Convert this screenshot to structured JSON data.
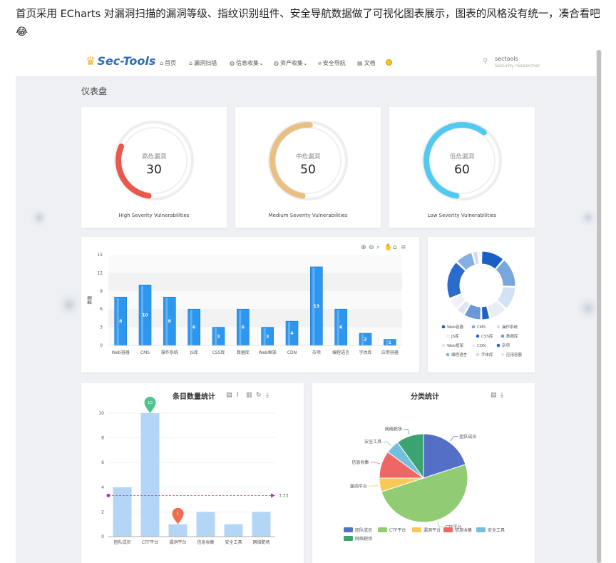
{
  "post": {
    "text": "首页采用 ECharts 对漏洞扫描的漏洞等级、指纹识别组件、安全导航数据做了可视化图表展示，图表的风格没有统一，凑合看吧😂"
  },
  "nav": {
    "logo": "Sec-Tools",
    "items": [
      {
        "icon": "home-icon",
        "label": "首页"
      },
      {
        "icon": "bank-icon",
        "label": "漏洞扫描"
      },
      {
        "icon": "globe-icon",
        "label": "信息收集⌄"
      },
      {
        "icon": "globe-icon",
        "label": "资产收集⌄"
      },
      {
        "icon": "ie-icon",
        "label": "安全导航"
      },
      {
        "icon": "file-icon",
        "label": "文档"
      }
    ],
    "user": {
      "name": "sectools",
      "role": "Security researcher"
    }
  },
  "dashboard": {
    "title": "仪表盘",
    "gauges": [
      {
        "label": "高危漏洞",
        "value": "30",
        "caption": "High Severity Vulnerabilities",
        "color": "#e8584b",
        "fraction": 0.3
      },
      {
        "label": "中危漏洞",
        "value": "50",
        "caption": "Medium Severity Vulnerabilities",
        "color": "#e9c083",
        "fraction": 0.5
      },
      {
        "label": "低危漏洞",
        "value": "60",
        "caption": "Low Severity Vulnerabilities",
        "color": "#52c9ef",
        "fraction": 0.6
      }
    ]
  },
  "chart_data": [
    {
      "type": "bar",
      "ylabel": "数量",
      "ylim": [
        0,
        15
      ],
      "yticks": [
        "0",
        "3",
        "6",
        "9",
        "12",
        "15"
      ],
      "categories": [
        "Web容器",
        "CMS",
        "操作系统",
        "JS库",
        "CSS库",
        "数据库",
        "Web框架",
        "CDN",
        "杂项",
        "编程语言",
        "字体库",
        "应用容器"
      ],
      "values": [
        8,
        10,
        8,
        6,
        3,
        6,
        3,
        4,
        13,
        6,
        2,
        1
      ],
      "color": "#2d96ee"
    },
    {
      "type": "pie",
      "donut": true,
      "legend": [
        "Web容器",
        "CMS",
        "操作系统",
        "JS库",
        "CSS库",
        "数据库",
        "Web框架",
        "CDN",
        "杂项",
        "编程语言",
        "字体库",
        "应用容器"
      ],
      "values": [
        8,
        10,
        8,
        6,
        3,
        6,
        3,
        4,
        13,
        6,
        2,
        1
      ],
      "colors": [
        "#1a5fc4",
        "#7aa6e0",
        "#d3e1f5",
        "#e9eef5",
        "#1f63c6",
        "#6d98d6",
        "#dde7f4",
        "#eef2f7",
        "#2a6bcb",
        "#86aee2",
        "#cddcf0",
        "#e4ebf5"
      ]
    },
    {
      "type": "bar",
      "title": "条目数量统计",
      "ylim": [
        0,
        10
      ],
      "yticks": [
        "0",
        "2",
        "4",
        "6",
        "8",
        "10"
      ],
      "categories": [
        "团队成员",
        "CTF平台",
        "漏洞平台",
        "信息收集",
        "安全工具",
        "网络靶场"
      ],
      "values": [
        4,
        10,
        1,
        2,
        1,
        2
      ],
      "max_marker": "10",
      "min_marker": "1",
      "average_line": "3.33",
      "color": "#b4d6f6"
    },
    {
      "type": "pie",
      "title": "分类统计",
      "categories": [
        "团队成员",
        "CTF平台",
        "漏洞平台",
        "信息收集",
        "安全工具",
        "网络靶场"
      ],
      "values": [
        4,
        10,
        1,
        2,
        1,
        2
      ],
      "colors": [
        "#5470c6",
        "#91cc75",
        "#fac858",
        "#ee6666",
        "#73c0de",
        "#3ba272"
      ]
    }
  ]
}
